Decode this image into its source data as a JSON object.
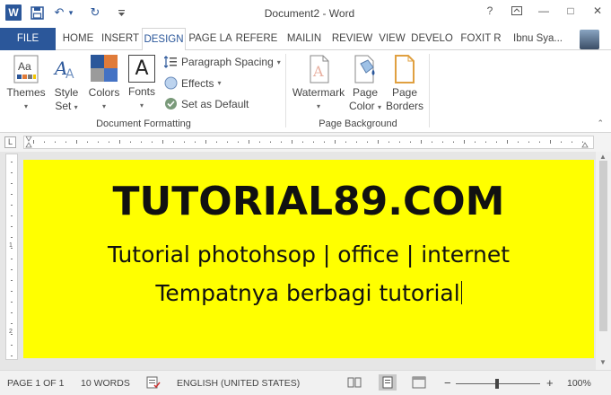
{
  "window": {
    "title": "Document2 - Word",
    "help": "?",
    "minimize": "—",
    "restore": "□",
    "close": "✕"
  },
  "qat": {
    "app_icon": "W",
    "undo_arrow": "↶",
    "redo_arrow": "↻",
    "save_icon": "save-icon",
    "customize": "▾"
  },
  "tabs": [
    "FILE",
    "HOME",
    "INSERT",
    "DESIGN",
    "PAGE LA",
    "REFERE",
    "MAILIN",
    "REVIEW",
    "VIEW",
    "DEVELO",
    "FOXIT R"
  ],
  "active_tab": "DESIGN",
  "user": "Ibnu Sya...",
  "ribbon": {
    "themes": "Themes",
    "style_set_1": "Style",
    "style_set_2": "Set",
    "colors": "Colors",
    "fonts": "Fonts",
    "paragraph_spacing": "Paragraph Spacing",
    "effects": "Effects",
    "set_as_default": "Set as Default",
    "group_document_formatting": "Document Formatting",
    "watermark": "Watermark",
    "page_color_1": "Page",
    "page_color_2": "Color",
    "page_borders_1": "Page",
    "page_borders_2": "Borders",
    "group_page_background": "Page Background",
    "fonts_glyph": "A",
    "ruler_corner": "L"
  },
  "document": {
    "headline": "TUTORIAL89.COM",
    "line2": "Tutorial photohsop | office | internet",
    "line3": "Tempatnya berbagi tutorial",
    "page_color": "#ffff00"
  },
  "status": {
    "page": "PAGE 1 OF 1",
    "words": "10 WORDS",
    "language": "ENGLISH (UNITED STATES)",
    "zoom_out": "−",
    "zoom_in": "+",
    "zoom": "100%"
  },
  "colors": {
    "accent": "#2b579a"
  }
}
